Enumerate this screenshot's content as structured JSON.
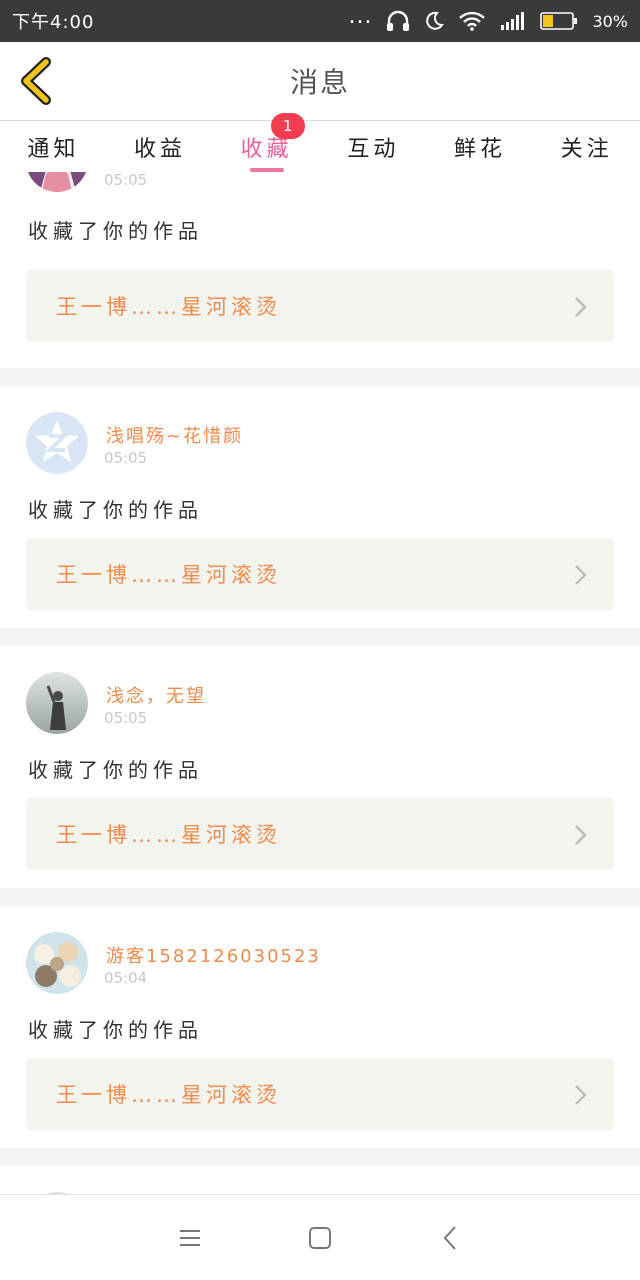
{
  "status_bar": {
    "time": "下午4:00",
    "dots": "...",
    "battery": "30%",
    "icons": [
      "headphones-icon",
      "moon-icon",
      "wifi-icon",
      "signal-icon",
      "battery-icon"
    ]
  },
  "header": {
    "title": "消息",
    "back_icon": "chevron-left-icon",
    "back_color": "#f0c419"
  },
  "tabs": [
    {
      "label": "通知",
      "active": false
    },
    {
      "label": "收益",
      "active": false
    },
    {
      "label": "收藏",
      "active": true,
      "badge": "1"
    },
    {
      "label": "互动",
      "active": false
    },
    {
      "label": "鲜花",
      "active": false
    },
    {
      "label": "关注",
      "active": false
    }
  ],
  "colors": {
    "accent_pink": "#e8629a",
    "badge_red": "#f23d51",
    "username_orange": "#f08a4b",
    "link_bg": "#f4f4ee"
  },
  "messages": [
    {
      "username": "",
      "time": "05:05",
      "action": "收藏了你的作品",
      "work_title": "王一博……星河滚烫",
      "avatar": "anime-girl-avatar"
    },
    {
      "username": "浅唱殇~花惜颜",
      "time": "05:05",
      "action": "收藏了你的作品",
      "work_title": "王一博……星河滚烫",
      "avatar": "default-z-avatar"
    },
    {
      "username": "浅念，无望",
      "time": "05:05",
      "action": "收藏了你的作品",
      "work_title": "王一博……星河滚烫",
      "avatar": "girl-photo-avatar"
    },
    {
      "username": "游客1582126030523",
      "time": "05:04",
      "action": "收藏了你的作品",
      "work_title": "王一博……星河滚烫",
      "avatar": "cartoon-cats-avatar"
    }
  ],
  "bottom_nav": [
    "menu-icon",
    "home-square-icon",
    "back-arrow-icon"
  ]
}
